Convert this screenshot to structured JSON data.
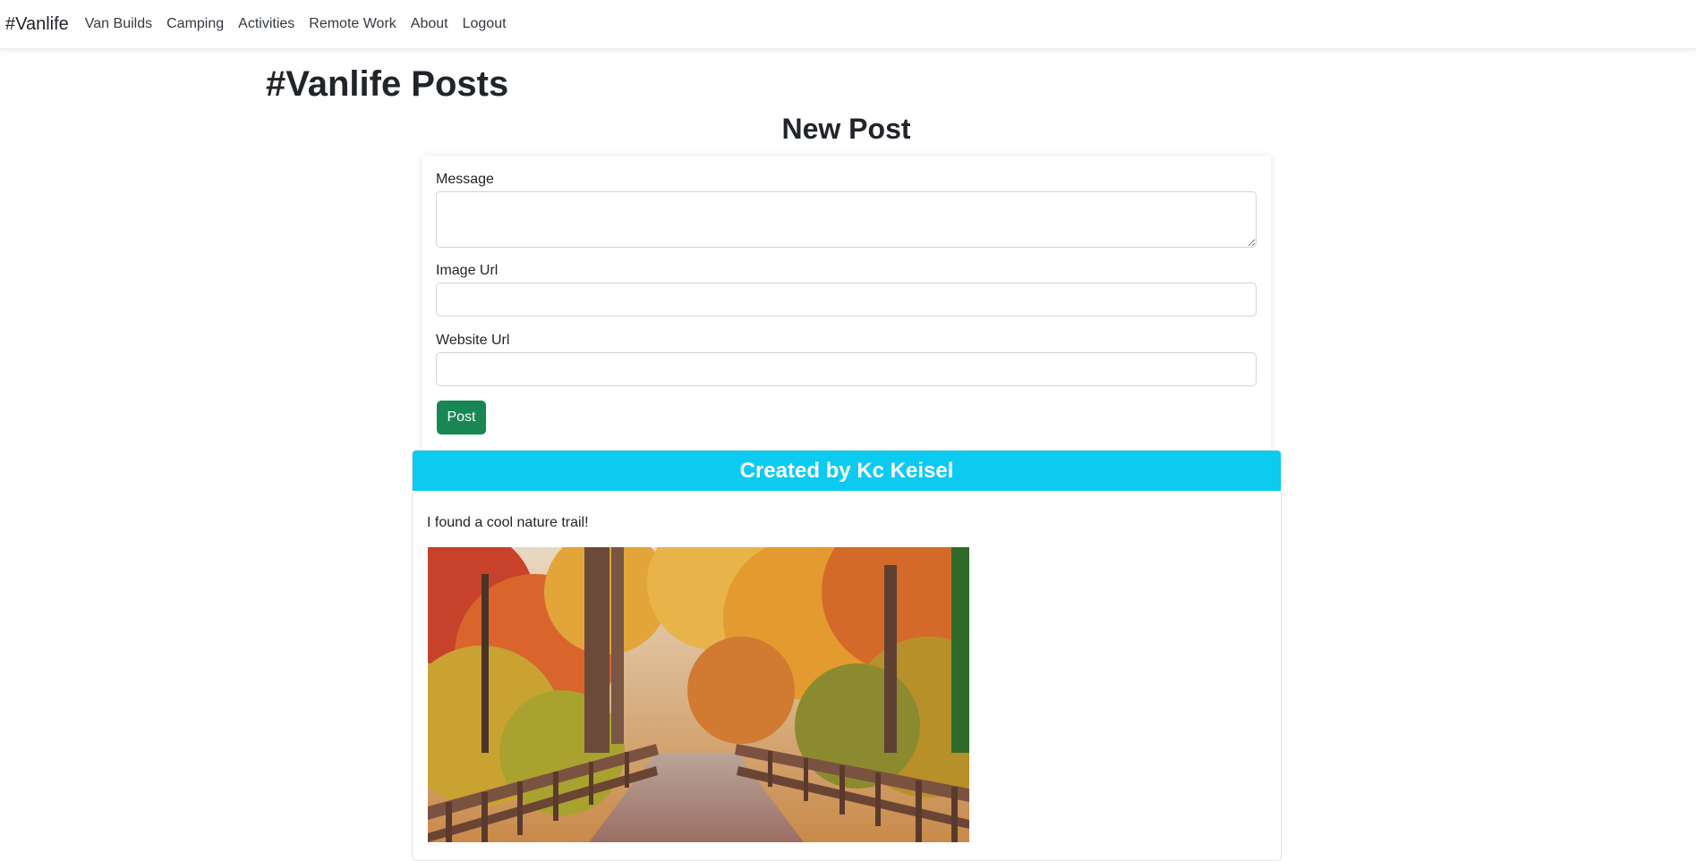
{
  "navbar": {
    "brand": "#Vanlife",
    "links": [
      "Van Builds",
      "Camping",
      "Activities",
      "Remote Work",
      "About",
      "Logout"
    ]
  },
  "page": {
    "title": "#Vanlife Posts",
    "new_post_title": "New Post"
  },
  "form": {
    "message_label": "Message",
    "message_value": "",
    "image_url_label": "Image Url",
    "image_url_value": "",
    "website_url_label": "Website Url",
    "website_url_value": "",
    "submit_label": "Post"
  },
  "posts": [
    {
      "header": "Created by Kc Keisel",
      "message": "I found a cool nature trail!",
      "image_alt": "autumn forest boardwalk"
    }
  ],
  "colors": {
    "post_button": "#198754",
    "post_header": "#0dcaf0"
  }
}
